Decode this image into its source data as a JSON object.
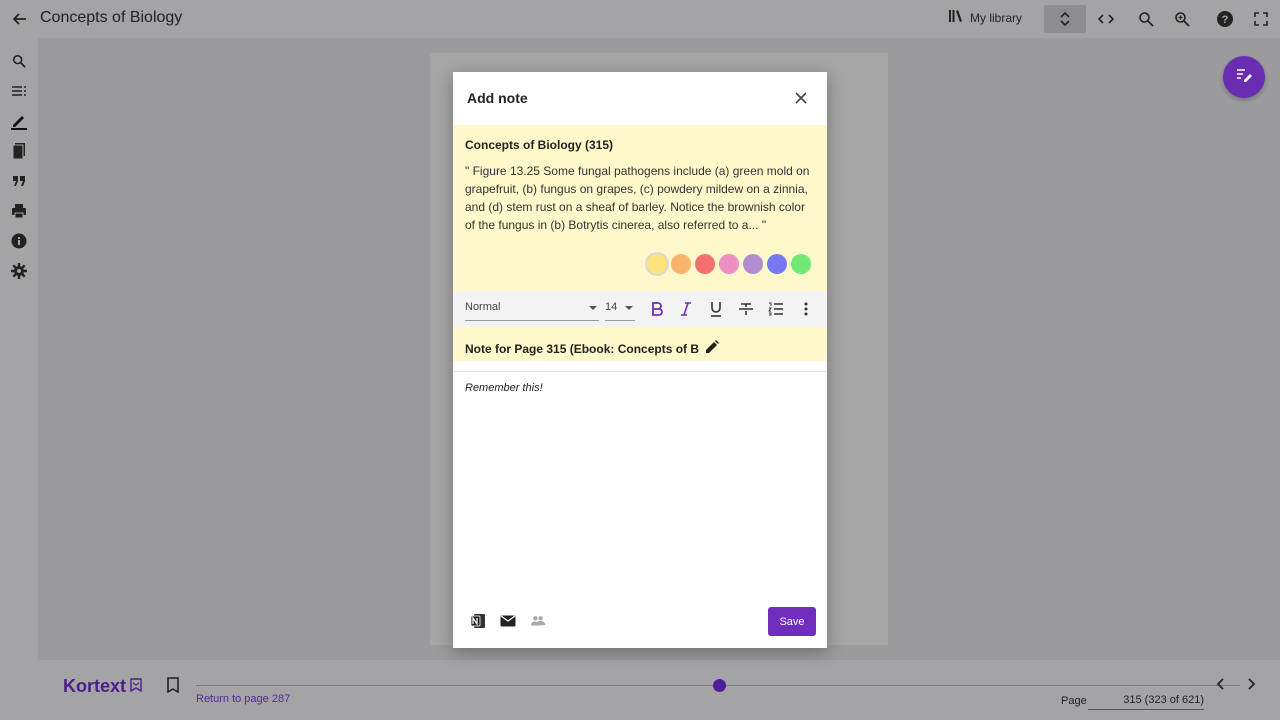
{
  "app": {
    "title": "Concepts of Biology",
    "my_library_label": "My library"
  },
  "bottom": {
    "brand": "Kortext",
    "return_link": "Return to page 287",
    "page_label": "Page",
    "page_value": "315 (323 of 621)",
    "slider_progress": 0.5
  },
  "modal": {
    "title": "Add note",
    "quote_title": "Concepts of Biology (315)",
    "quote_text": "\" Figure 13.25 Some fungal pathogens include (a) green mold on grapefruit, (b) fungus on grapes, (c) powdery mildew on a zinnia, and (d) stem rust on a sheaf of barley. Notice the brownish color of the fungus in (b) Botrytis cinerea, also referred to a... \"",
    "colors": [
      "#ffe27a",
      "#f8b46c",
      "#f46f6f",
      "#ee8fc4",
      "#b38dd2",
      "#7779f2",
      "#73e873"
    ],
    "selected_color_index": 0,
    "toolbar": {
      "format": "Normal",
      "size": "14"
    },
    "note_title": "Note for Page 315 (Ebook: Concepts of B",
    "note_body": "Remember this!",
    "save_label": "Save"
  }
}
